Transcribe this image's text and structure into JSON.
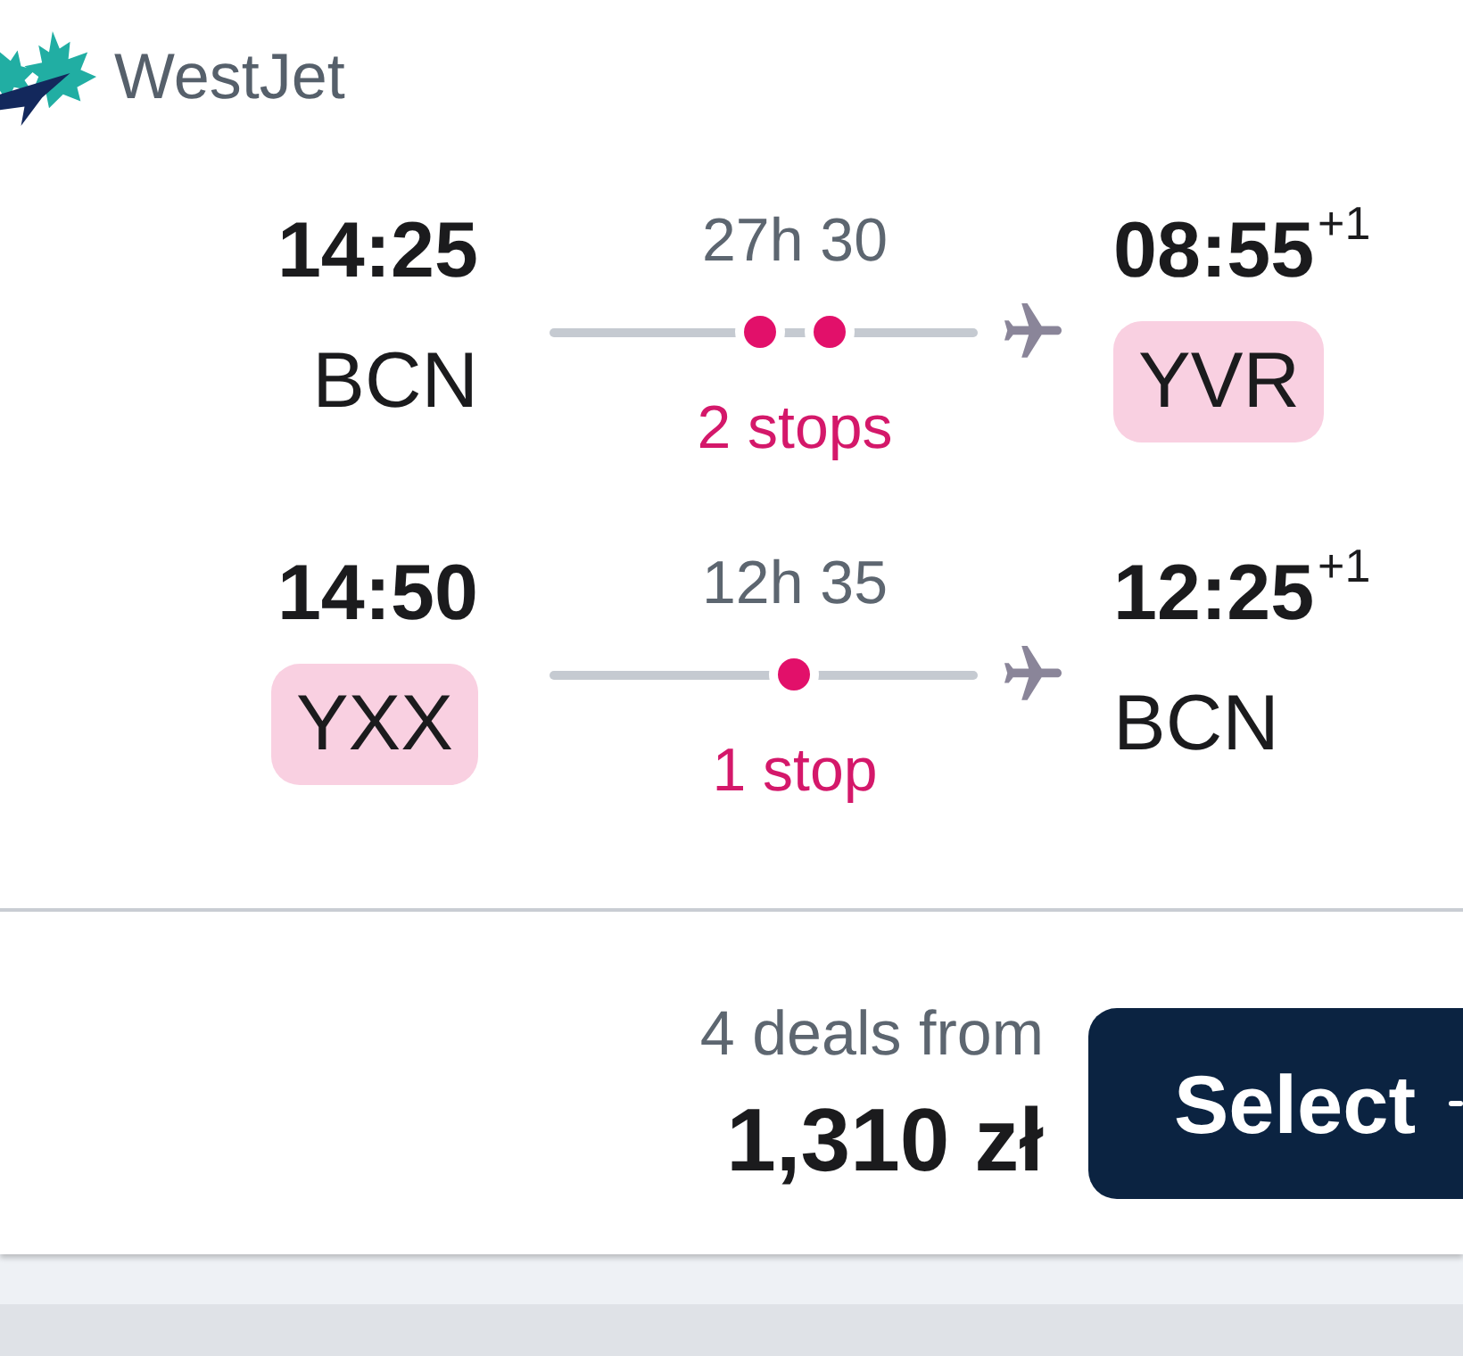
{
  "airline": {
    "name": "WestJet"
  },
  "legs": [
    {
      "departure": {
        "time": "14:25",
        "airport": "BCN",
        "highlighted": false
      },
      "duration": "27h 30",
      "stops": "2 stops",
      "stop_marks": [
        {
          "kind": "dot"
        },
        {
          "kind": "dot"
        }
      ],
      "arrival": {
        "time": "08:55",
        "day_offset": "+1",
        "airport": "YVR",
        "highlighted": true
      }
    },
    {
      "departure": {
        "time": "14:50",
        "airport": "YXX",
        "highlighted": true
      },
      "duration": "12h 35",
      "stops": "1 stop",
      "stop_marks": [
        {
          "kind": "dot"
        }
      ],
      "arrival": {
        "time": "12:25",
        "day_offset": "+1",
        "airport": "BCN",
        "highlighted": false
      }
    }
  ],
  "price": {
    "deals": "4 deals from",
    "amount": "1,310 zł"
  },
  "select_button": {
    "label": "Select"
  }
}
